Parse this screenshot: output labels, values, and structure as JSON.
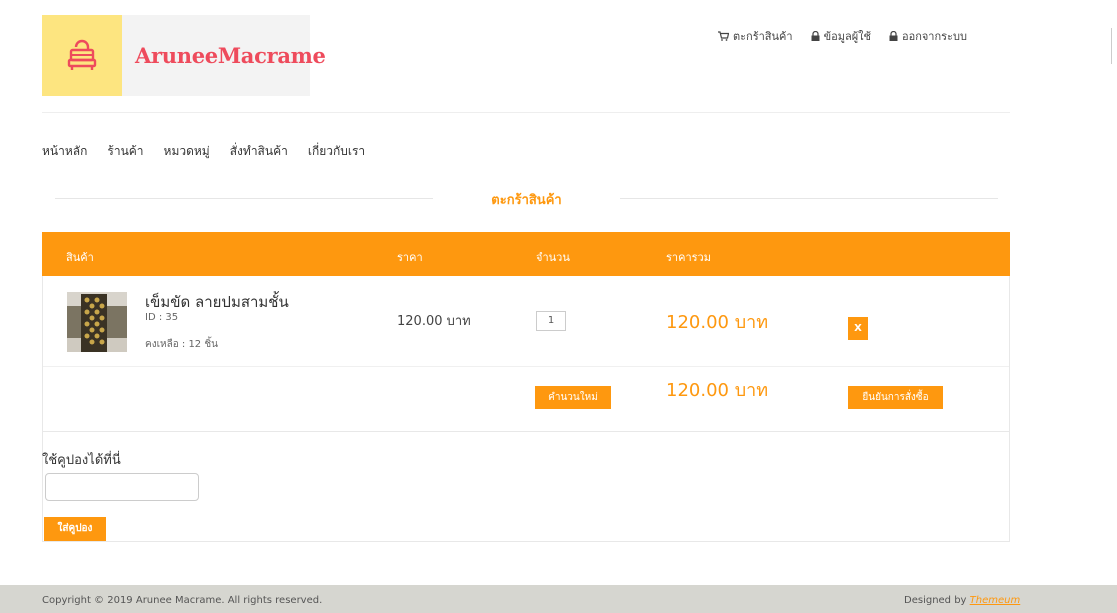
{
  "brand": {
    "name": "AruneeMacrame"
  },
  "top_links": [
    {
      "label": "ตะกร้าสินค้า",
      "icon": "cart-icon"
    },
    {
      "label": "ข้อมูลผู้ใช้",
      "icon": "lock-icon"
    },
    {
      "label": "ออกจากระบบ",
      "icon": "lock-icon"
    }
  ],
  "nav": [
    "หน้าหลัก",
    "ร้านค้า",
    "หมวดหมู่",
    "สั่งทำสินค้า",
    "เกี่ยวกับเรา"
  ],
  "section_title": "ตะกร้าสินค้า",
  "cart": {
    "headers": [
      "สินค้า",
      "ราคา",
      "จำนวน",
      "ราคารวม"
    ],
    "item": {
      "name": "เข็มขัด ลายปมสามชั้น",
      "id": "ID : 35",
      "stock": "คงเหลือ : 12 ชิ้น",
      "price": "120.00 บาท",
      "quantity": "1",
      "total": "120.00 บาท",
      "remove_label": "X"
    },
    "recalc_label": "คำนวนใหม่",
    "grand_total": "120.00 บาท",
    "confirm_label": "ยืนยันการสั่งซื้อ"
  },
  "coupon": {
    "label": "ใช้คูปองได้ที่นี่",
    "value": "",
    "button": "ใส่คูปอง"
  },
  "footer": {
    "copyright": "Copyright © 2019 Arunee Macrame. All rights reserved.",
    "designed_by": "Designed by",
    "designer": "Themeum"
  },
  "colors": {
    "accent": "#fe980f",
    "brand_text": "#ee4b5c",
    "logo_bg": "#fde580"
  }
}
